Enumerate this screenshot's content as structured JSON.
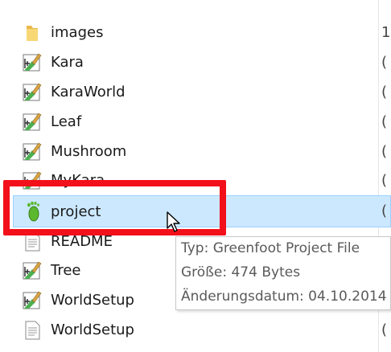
{
  "files": [
    {
      "name": "images",
      "icon": "folder-icon",
      "trail": "1"
    },
    {
      "name": "Kara",
      "icon": "java-file-icon",
      "trail": "("
    },
    {
      "name": "KaraWorld",
      "icon": "java-file-icon",
      "trail": "("
    },
    {
      "name": "Leaf",
      "icon": "java-file-icon",
      "trail": "("
    },
    {
      "name": "Mushroom",
      "icon": "java-file-icon",
      "trail": "("
    },
    {
      "name": "MyKara",
      "icon": "java-file-icon",
      "trail": "("
    },
    {
      "name": "project",
      "icon": "greenfoot-project-icon",
      "trail": "(",
      "selected": true
    },
    {
      "name": "README",
      "icon": "text-file-icon",
      "trail": ""
    },
    {
      "name": "Tree",
      "icon": "java-file-icon",
      "trail": "("
    },
    {
      "name": "WorldSetup",
      "icon": "java-file-icon",
      "trail": "("
    },
    {
      "name": "WorldSetup",
      "icon": "text-file-icon",
      "trail": "("
    }
  ],
  "tooltip": {
    "type_line": "Typ: Greenfoot Project File",
    "size_line": "Größe: 474 Bytes",
    "date_line": "Änderungsdatum: 04.10.2014"
  },
  "colors": {
    "selection_bg": "#cce8ff",
    "selection_border": "#99d1ff",
    "highlight": "#f2101a"
  }
}
